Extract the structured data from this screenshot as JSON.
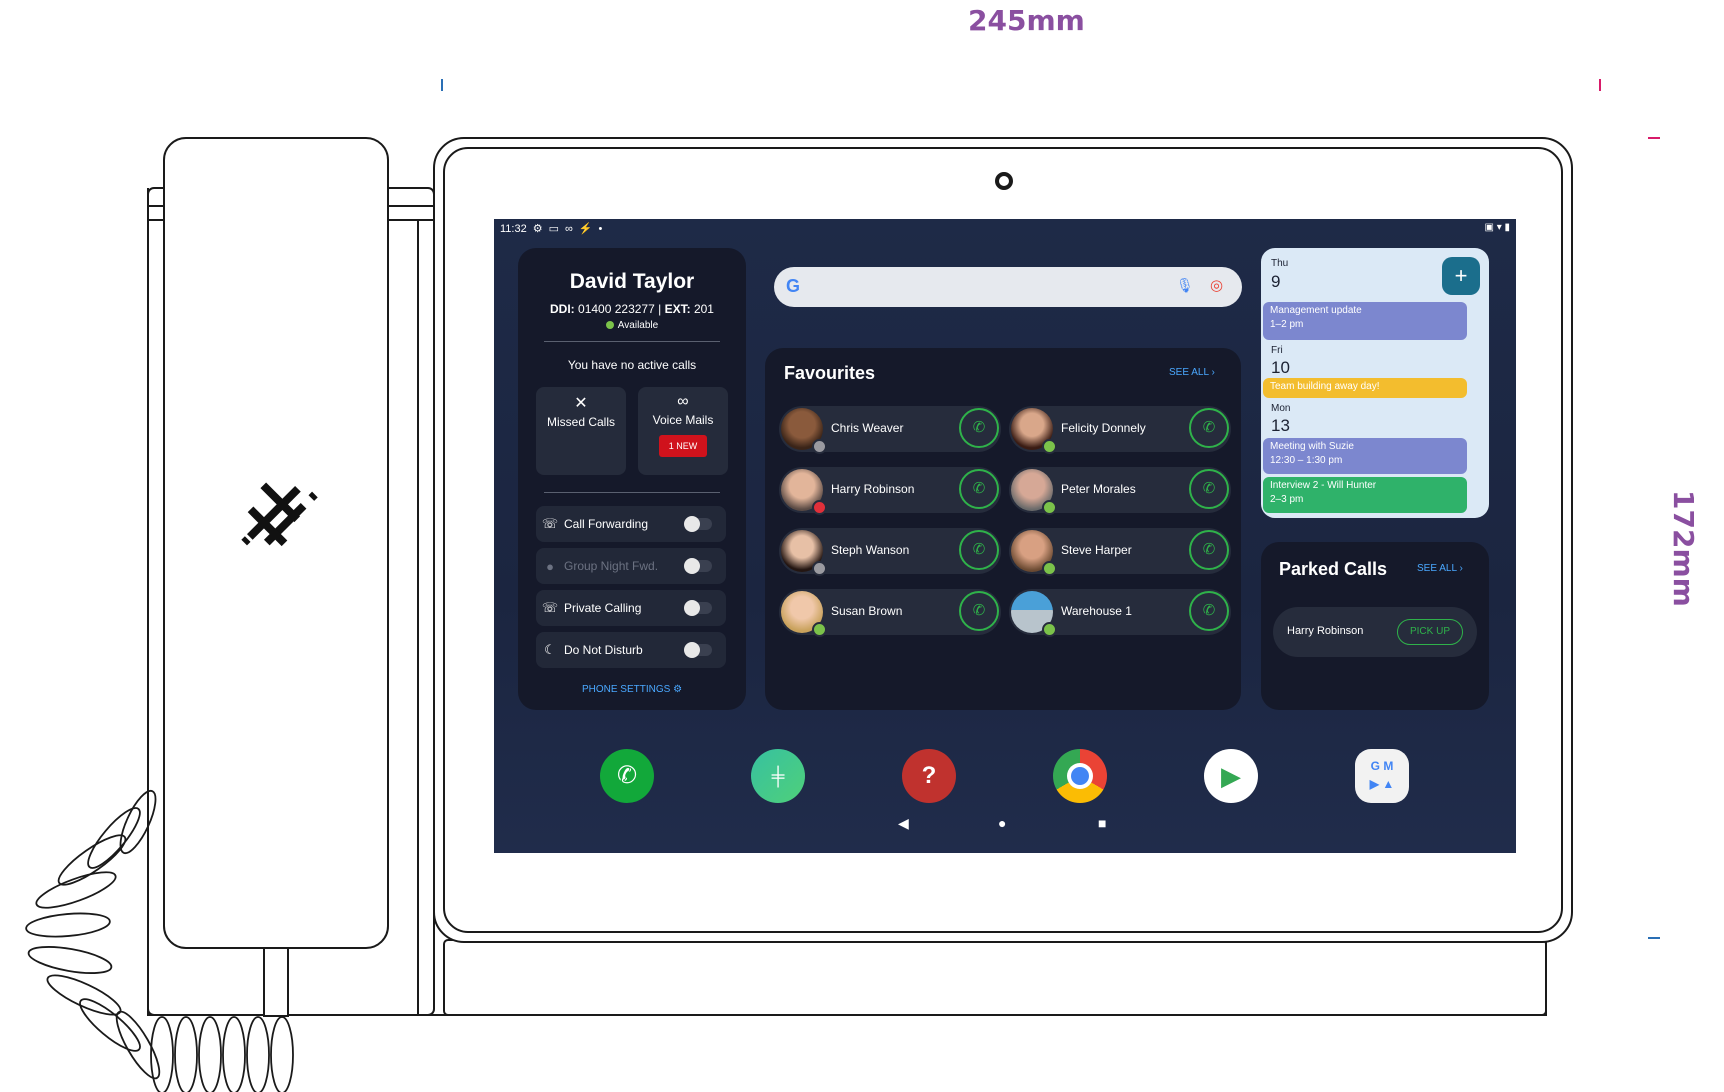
{
  "dimensions": {
    "width_label": "245mm",
    "height_label": "172mm"
  },
  "status_bar": {
    "time": "11:32"
  },
  "user": {
    "name": "David Taylor",
    "ddi_label": "DDI:",
    "ddi": "01400 223277",
    "ext_label": "EXT:",
    "ext": "201",
    "status": "Available",
    "no_calls": "You have no active calls"
  },
  "tiles": {
    "missed_calls": "Missed Calls",
    "voice_mails": "Voice Mails",
    "voice_mails_badge": "1 NEW"
  },
  "toggles": [
    {
      "label": "Call Forwarding",
      "icon": "call-forward-icon",
      "enabled": true
    },
    {
      "label": "Group Night Fwd.",
      "icon": "person-icon",
      "enabled": false
    },
    {
      "label": "Private Calling",
      "icon": "private-call-icon",
      "enabled": true
    },
    {
      "label": "Do Not Disturb",
      "icon": "moon-icon",
      "enabled": true
    }
  ],
  "phone_settings": "PHONE SETTINGS",
  "favourites": {
    "title": "Favourites",
    "see_all": "SEE ALL",
    "contacts": [
      {
        "name": "Chris Weaver",
        "presence": "offline",
        "color": "#9a9aa0"
      },
      {
        "name": "Felicity Donnely",
        "presence": "available",
        "color": "#7bc24a"
      },
      {
        "name": "Harry Robinson",
        "presence": "busy",
        "color": "#e0303a"
      },
      {
        "name": "Peter Morales",
        "presence": "available",
        "color": "#7bc24a"
      },
      {
        "name": "Steph Wanson",
        "presence": "offline",
        "color": "#9a9aa0"
      },
      {
        "name": "Steve Harper",
        "presence": "available",
        "color": "#7bc24a"
      },
      {
        "name": "Susan Brown",
        "presence": "available",
        "color": "#7bc24a"
      },
      {
        "name": "Warehouse 1",
        "presence": "available",
        "color": "#7bc24a"
      }
    ]
  },
  "calendar": {
    "days": [
      {
        "weekday": "Thu",
        "date": "9"
      },
      {
        "weekday": "Fri",
        "date": "10"
      },
      {
        "weekday": "Mon",
        "date": "13"
      }
    ],
    "events": [
      {
        "title": "Management update",
        "time": "1–2 pm"
      },
      {
        "title": "Team building away day!"
      },
      {
        "title": "Meeting with Suzie",
        "time": "12:30 – 1:30 pm"
      },
      {
        "title": "Interview 2 - Will Hunter",
        "time": "2–3 pm"
      }
    ],
    "add_label": "+"
  },
  "parked_calls": {
    "title": "Parked Calls",
    "see_all": "SEE ALL",
    "caller": "Harry Robinson",
    "action": "PICK UP"
  },
  "dock_apps": [
    "phone-app-icon",
    "there-app-icon",
    "help-app-icon",
    "chrome-app-icon",
    "play-store-app-icon",
    "google-apps-folder-icon"
  ],
  "colors": {
    "accent_green": "#2fb24a",
    "link_blue": "#4aa8ff",
    "badge_red": "#d0121c",
    "available": "#7bc24a"
  }
}
